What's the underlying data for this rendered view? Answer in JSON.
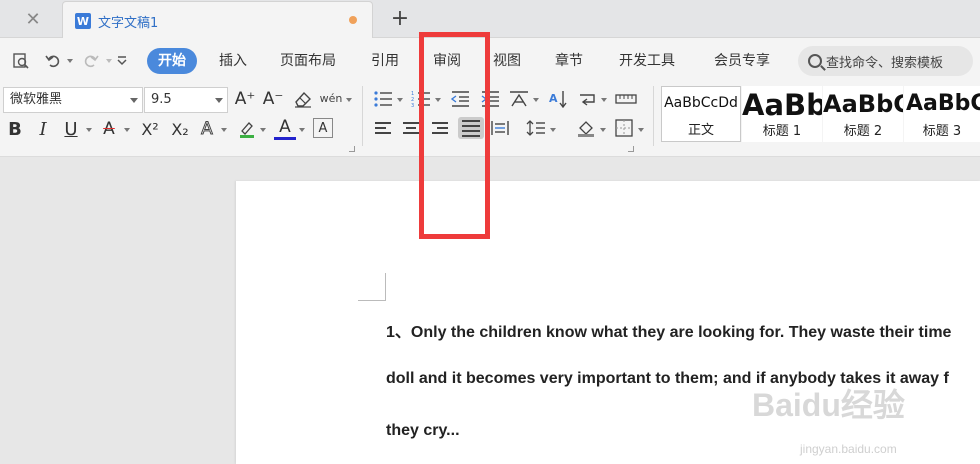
{
  "tabs": {
    "document_title": "文字文稿1",
    "doc_icon_letter": "W",
    "close_glyph": "✕",
    "add_glyph": "+"
  },
  "menu": {
    "items": [
      "开始",
      "插入",
      "页面布局",
      "引用",
      "审阅",
      "视图",
      "章节",
      "开发工具",
      "会员专享"
    ],
    "search_placeholder": "查找命令、搜索模板"
  },
  "font": {
    "family": "微软雅黑",
    "size": "9.5"
  },
  "buttons": {
    "bold": "B",
    "italic": "I",
    "underline": "U",
    "strike_color": "A",
    "superscript": "X²",
    "subscript": "X₂",
    "text_effect": "A",
    "font_color": "A",
    "clear_format": "A",
    "grow_font": "A⁺",
    "shrink_font": "A⁻",
    "pinyin": "wén"
  },
  "styles": [
    {
      "sample": "AaBbCcDd",
      "name": "正文"
    },
    {
      "sample": "AaBb",
      "name": "标题 1"
    },
    {
      "sample": "AaBbC",
      "name": "标题 2"
    },
    {
      "sample": "AaBbC",
      "name": "标题 3"
    }
  ],
  "document": {
    "lines": [
      "1、Only the children know what they are looking for. They waste their time",
      "doll and it becomes very important to them; and if anybody takes it away f",
      "they cry..."
    ]
  },
  "watermark": {
    "brand": "Baidu经验",
    "url": "jingyan.baidu.com"
  },
  "colors": {
    "accent": "#4a89dc",
    "highlight": "#ee3b3b",
    "tab_title": "#2f6fc6",
    "unsaved_dot": "#f0a15a"
  }
}
